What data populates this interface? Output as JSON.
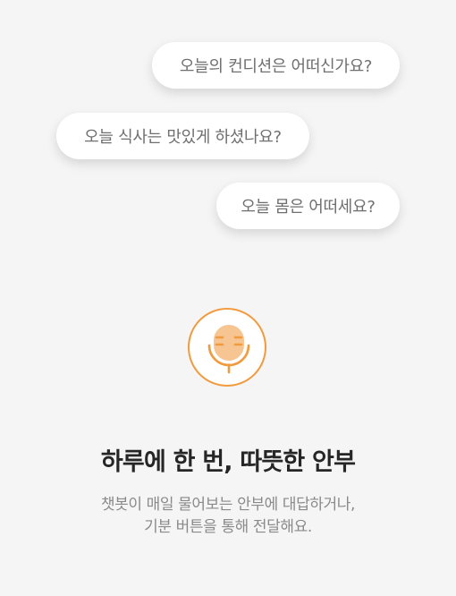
{
  "chat_bubbles": [
    {
      "text": "오늘의 컨디션은 어떠신가요?"
    },
    {
      "text": "오늘 식사는 맛있게 하셨나요?"
    },
    {
      "text": "오늘 몸은 어떠세요?"
    }
  ],
  "microphone": {
    "icon": "microphone-icon",
    "accent_color": "#f19a3e",
    "fill_color": "#f6c592"
  },
  "headline": "하루에 한 번, 따뜻한 안부",
  "description": {
    "line1": "챗봇이 매일 물어보는 안부에 대답하거나,",
    "line2": "기분 버튼을 통해 전달해요."
  }
}
